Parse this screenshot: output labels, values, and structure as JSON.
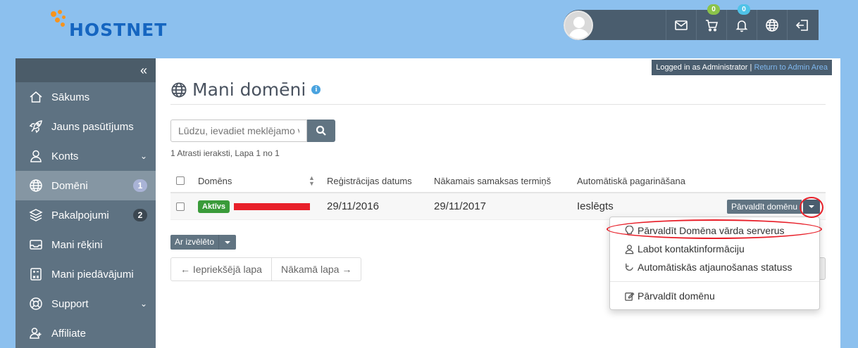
{
  "brand": {
    "logo_text": "HOSTNET",
    "accent": "#f7941d",
    "logo_color": "#1565c0"
  },
  "header": {
    "cart_count": "0",
    "notification_count": "0",
    "icons": [
      "mail-icon",
      "cart-icon",
      "bell-icon",
      "globe-icon",
      "logout-icon"
    ]
  },
  "sidebar": {
    "collapse_glyph": "«",
    "items": [
      {
        "label": "Sākums",
        "icon": "home-icon"
      },
      {
        "label": "Jauns pasūtījums",
        "icon": "rocket-icon"
      },
      {
        "label": "Konts",
        "icon": "user-icon",
        "chevron": "⌄"
      },
      {
        "label": "Domēni",
        "icon": "globe-icon",
        "badge": "1",
        "active": true
      },
      {
        "label": "Pakalpojumi",
        "icon": "layers-icon",
        "badge": "2"
      },
      {
        "label": "Mani rēķini",
        "icon": "inbox-icon"
      },
      {
        "label": "Mani piedāvājumi",
        "icon": "calculator-icon"
      },
      {
        "label": "Support",
        "icon": "lifebuoy-icon",
        "chevron": "⌄"
      },
      {
        "label": "Affiliate",
        "icon": "affiliate-icon"
      }
    ]
  },
  "admin_bar": {
    "text": "Logged in as Administrator |",
    "link": "Return to Admin Area"
  },
  "page": {
    "title": "Mani domēni",
    "info_glyph": "i",
    "search_placeholder": "Lūdzu, ievadiet meklējamo vārdu",
    "results_info": "1 Atrasti ieraksti, Lapa 1 no 1"
  },
  "table": {
    "headers": [
      "Domēns",
      "Reģistrācijas datums",
      "Nākamais samaksas termiņš",
      "Automātiskā pagarināšana"
    ],
    "rows": [
      {
        "status": "Aktīvs",
        "reg_date": "29/11/2016",
        "next_due": "29/11/2017",
        "auto_renew": "Ieslēgts",
        "manage_label": "Pārvaldīt domēnu"
      }
    ]
  },
  "bulk": {
    "label": "Ar izvēlēto"
  },
  "pagination": {
    "prev": "← Iepriekšējā lapa",
    "next": "Nākamā lapa →"
  },
  "dropdown": {
    "items": [
      {
        "label": "Pārvaldīt Domēna vārda serverus",
        "icon": "bulb-icon"
      },
      {
        "label": "Labot kontaktinformāciju",
        "icon": "user-icon"
      },
      {
        "label": "Automātiskās atjaunošanas statuss",
        "icon": "refresh-icon"
      },
      {
        "label": "Pārvaldīt domēnu",
        "icon": "edit-icon"
      }
    ]
  },
  "colors": {
    "sidebar": "#5e7282",
    "header_bar": "#4a5d6e",
    "success": "#3a9b3a",
    "highlight": "#e8202a"
  }
}
